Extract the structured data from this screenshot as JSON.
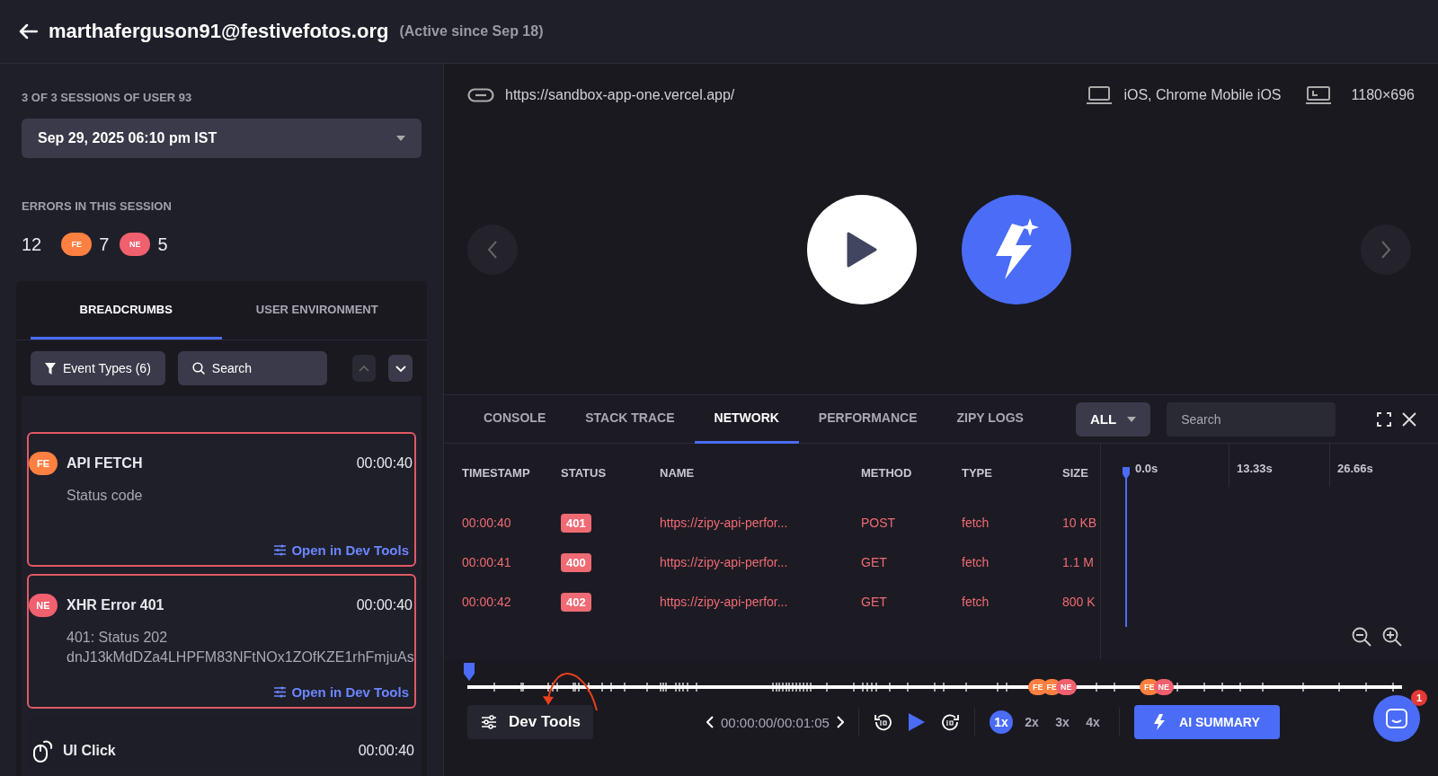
{
  "header": {
    "title": "marthaferguson91@festivefotos.org",
    "subtitle": "(Active since Sep 18)"
  },
  "sidebar": {
    "sessions_label": "3 OF 3 SESSIONS OF USER 93",
    "session_select": "Sep 29, 2025 06:10 pm IST",
    "errors_label": "ERRORS IN THIS SESSION",
    "errors_total": "12",
    "error_counts": [
      {
        "badge": "FE",
        "count": "7",
        "color": "#ff8040"
      },
      {
        "badge": "NE",
        "count": "5",
        "color": "#f0606e"
      }
    ],
    "tabs": [
      {
        "label": "BREADCRUMBS",
        "selected": true
      },
      {
        "label": "USER ENVIRONMENT",
        "selected": false
      }
    ],
    "filter_button": "Event Types (6)",
    "search": {
      "placeholder": "Search"
    },
    "events": [
      {
        "kind": "error",
        "badge": "FE",
        "color": "#ff8040",
        "title": "API FETCH",
        "time": "00:00:40",
        "details": [
          "Status code"
        ],
        "link": "Open in Dev Tools"
      },
      {
        "kind": "error",
        "badge": "NE",
        "color": "#f0606e",
        "title": "XHR Error 401",
        "time": "00:00:40",
        "details": [
          "401: Status 202",
          "dnJ13kMdDZa4LHPFM83NFtNOx1ZOfKZE1rhFmjuAs"
        ],
        "link": "Open in Dev Tools"
      },
      {
        "kind": "click",
        "title": "UI Click",
        "time": "00:00:40"
      }
    ]
  },
  "player": {
    "url": "https://sandbox-app-one.vercel.app/",
    "device": "iOS, Chrome Mobile iOS",
    "resolution": "1180×696"
  },
  "devtools": {
    "tabs": [
      {
        "label": "CONSOLE",
        "selected": false
      },
      {
        "label": "STACK TRACE",
        "selected": false
      },
      {
        "label": "NETWORK",
        "selected": true
      },
      {
        "label": "PERFORMANCE",
        "selected": false
      },
      {
        "label": "ZIPY LOGS",
        "selected": false
      }
    ],
    "filter": "ALL",
    "search": {
      "placeholder": "Search"
    },
    "columns": [
      "TIMESTAMP",
      "STATUS",
      "NAME",
      "METHOD",
      "TYPE",
      "SIZE"
    ],
    "waterfall_ticks": [
      "0.0s",
      "13.33s",
      "26.66s"
    ],
    "rows": [
      {
        "failed": true,
        "timestamp": "00:00:40",
        "status": "401",
        "name": "https://zipy-api-perfor...",
        "method": "POST",
        "type": "fetch",
        "size": "10 KB"
      },
      {
        "failed": true,
        "timestamp": "00:00:41",
        "status": "400",
        "name": "https://zipy-api-perfor...",
        "method": "GET",
        "type": "fetch",
        "size": "1.1 M"
      },
      {
        "failed": true,
        "timestamp": "00:00:42",
        "status": "402",
        "name": "https://zipy-api-perfor...",
        "method": "GET",
        "type": "fetch",
        "size": "800 K"
      }
    ]
  },
  "timeline": {
    "marker_groups": [
      [
        {
          "badge": "FE",
          "color": "#ff8040"
        },
        {
          "badge": "FE",
          "color": "#ff8040"
        },
        {
          "badge": "NE",
          "color": "#f0606e"
        }
      ],
      [
        {
          "badge": "FE",
          "color": "#ff8040"
        },
        {
          "badge": "NE",
          "color": "#f0606e"
        }
      ]
    ]
  },
  "controls": {
    "dev_tools": "Dev Tools",
    "time": "00:00:00/00:01:05",
    "speeds": [
      {
        "label": "1x",
        "selected": true
      },
      {
        "label": "2x",
        "selected": false
      },
      {
        "label": "3x",
        "selected": false
      },
      {
        "label": "4x",
        "selected": false
      }
    ],
    "ai_summary": "AI SUMMARY",
    "chat_badge": "1"
  }
}
